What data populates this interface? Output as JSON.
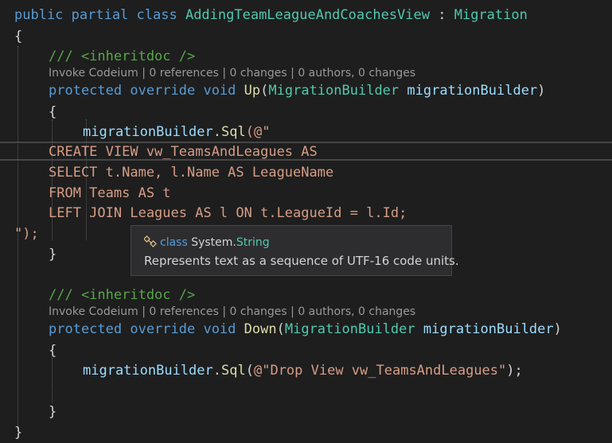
{
  "code": {
    "l0": {
      "kw": "public partial class",
      "cls": "AddingTeamLeagueAndCoachesView",
      "sep": " : ",
      "base": "Migration"
    },
    "brace_open": "{",
    "brace_close": "}",
    "up_comment": "/// <inheritdoc />",
    "up_lens": {
      "codeium": "Invoke Codeium",
      "references": "0 references",
      "changes": "0 changes",
      "authors": "0 authors, 0 changes",
      "separator": " | "
    },
    "up_sig": {
      "kw": "protected override void",
      "name": "Up",
      "ptype": "MigrationBuilder",
      "pname": "migrationBuilder"
    },
    "up_body": {
      "obj": "migrationBuilder",
      "method": "Sql",
      "open": "(@\""
    },
    "sql": [
      "CREATE VIEW vw_TeamsAndLeagues AS",
      "SELECT t.Name, l.Name AS LeagueName",
      "FROM Teams AS t",
      "LEFT JOIN Leagues AS l ON t.LeagueId = l.Id;"
    ],
    "sql_close": "\");",
    "down_comment": "/// <inheritdoc />",
    "down_lens": {
      "codeium": "Invoke Codeium",
      "references": "0 references",
      "changes": "0 changes",
      "authors": "0 authors, 0 changes",
      "separator": " | "
    },
    "down_sig": {
      "kw": "protected override void",
      "name": "Down",
      "ptype": "MigrationBuilder",
      "pname": "migrationBuilder"
    },
    "down_body": {
      "obj": "migrationBuilder",
      "method": "Sql",
      "arg": "@\"Drop View vw_TeamsAndLeagues\"",
      "end": ");"
    }
  },
  "tooltip": {
    "icon": "class-icon",
    "keyword": "class",
    "namespace": "System.",
    "type": "String",
    "description": "Represents text as a sequence of UTF-16 code units."
  },
  "colors": {
    "background": "#1e1e1e",
    "keyword": "#569cd6",
    "type": "#4ec9b0",
    "method": "#dcdcaa",
    "comment": "#57a64a",
    "string": "#d69d85",
    "parameter": "#9cdcfe"
  }
}
